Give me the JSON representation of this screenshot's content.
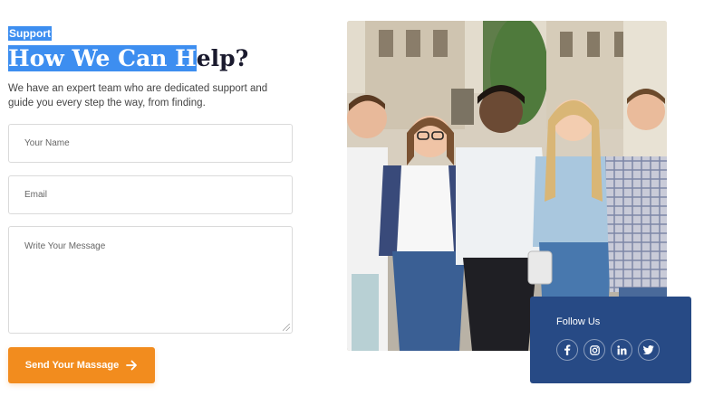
{
  "contact": {
    "eyebrow": "Support",
    "heading_selected_a": "How We ",
    "heading_selected_bold": "Can",
    "heading_selected_b": " H",
    "heading_rest": "elp?",
    "intro": "We have an expert team who are dedicated support and guide you every step the way, from finding.",
    "name_placeholder": "Your Name",
    "email_placeholder": "Email",
    "message_placeholder": "Write Your Message",
    "send_label": "Send Your Massage"
  },
  "follow": {
    "title": "Follow Us",
    "icons": [
      "facebook-icon",
      "instagram-icon",
      "linkedin-icon",
      "twitter-icon"
    ]
  },
  "colors": {
    "accent_orange": "#f28c1e",
    "panel_blue": "#274a85",
    "selection_blue": "#3d8ef0"
  }
}
